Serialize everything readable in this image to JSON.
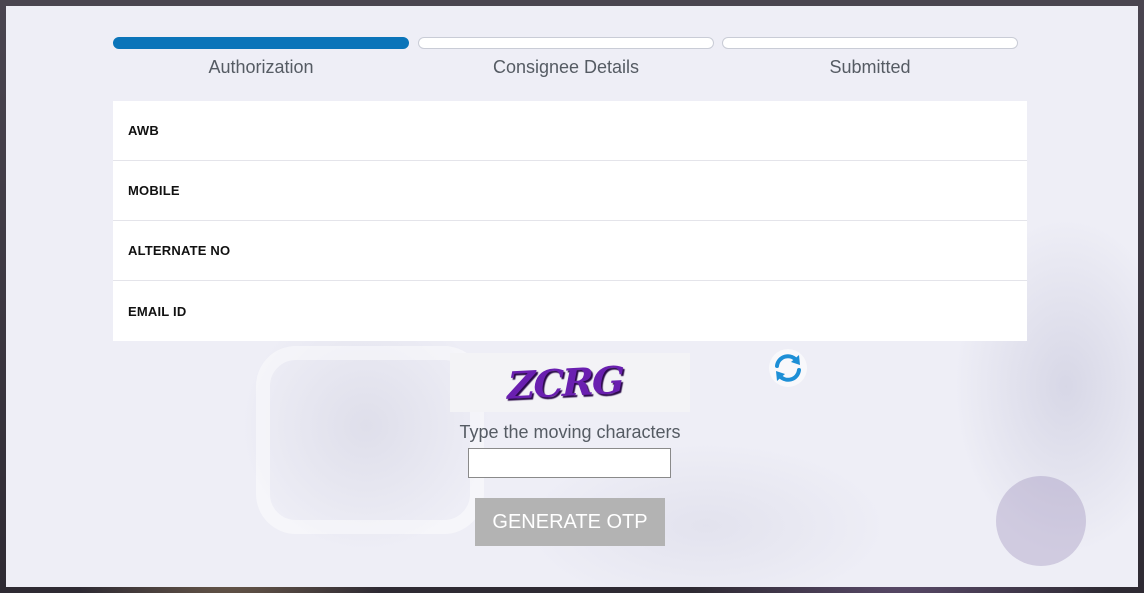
{
  "steps": [
    {
      "label": "Authorization",
      "active": true
    },
    {
      "label": "Consignee Details",
      "active": false
    },
    {
      "label": "Submitted",
      "active": false
    }
  ],
  "form": {
    "fields": [
      {
        "label": "AWB"
      },
      {
        "label": "MOBILE"
      },
      {
        "label": "ALTERNATE NO"
      },
      {
        "label": "EMAIL ID"
      }
    ]
  },
  "captcha": {
    "image_text": "ZCRG",
    "caption": "Type the moving characters",
    "input_value": "",
    "refresh_icon": "refresh-icon"
  },
  "actions": {
    "generate_otp_label": "GENERATE OTP"
  },
  "colors": {
    "progress_active": "#0a74b9",
    "button_disabled": "#b3b3b3",
    "captcha_text": "#6a1fb0"
  }
}
